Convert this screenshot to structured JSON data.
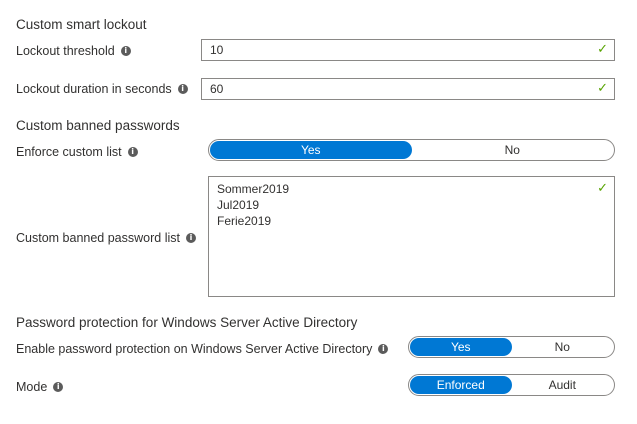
{
  "smart_lockout": {
    "title": "Custom smart lockout",
    "threshold_label": "Lockout threshold",
    "threshold_value": "10",
    "duration_label": "Lockout duration in seconds",
    "duration_value": "60"
  },
  "banned_passwords": {
    "title": "Custom banned passwords",
    "enforce_label": "Enforce custom list",
    "enforce_yes": "Yes",
    "enforce_no": "No",
    "enforce_selected": "Yes",
    "list_label": "Custom banned password list",
    "list_items": [
      "Sommer2019",
      "Jul2019",
      "Ferie2019"
    ]
  },
  "windows_protection": {
    "title": "Password protection for Windows Server Active Directory",
    "enable_label": "Enable password protection on Windows Server Active Directory",
    "enable_yes": "Yes",
    "enable_no": "No",
    "enable_selected": "Yes",
    "mode_label": "Mode",
    "mode_enforced": "Enforced",
    "mode_audit": "Audit",
    "mode_selected": "Enforced"
  },
  "icons": {
    "info": "info-icon",
    "valid": "checkmark-icon"
  },
  "colors": {
    "accent": "#0078d4",
    "valid": "#57a300",
    "border": "#8a8886"
  }
}
